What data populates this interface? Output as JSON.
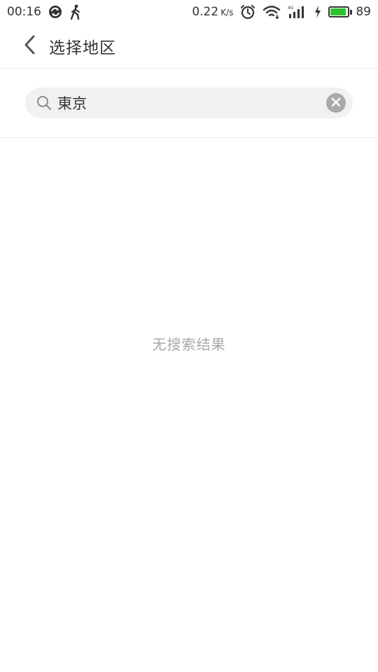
{
  "status_bar": {
    "time": "00:16",
    "network_speed": "0.22",
    "network_speed_unit": "K/s",
    "battery_level": "89",
    "battery_fraction": 0.89,
    "battery_color": "#2bc42b",
    "icons": [
      "sync-icon",
      "walking-icon",
      "alarm-icon",
      "wifi-icon",
      "signal-4g-icon",
      "charging-icon",
      "battery-icon"
    ]
  },
  "header": {
    "title": "选择地区",
    "back_icon": "chevron-left-icon"
  },
  "search": {
    "value": "東京",
    "placeholder": "",
    "search_icon": "search-icon",
    "clear_icon": "close-icon"
  },
  "results": {
    "empty_message": "无搜索结果"
  }
}
